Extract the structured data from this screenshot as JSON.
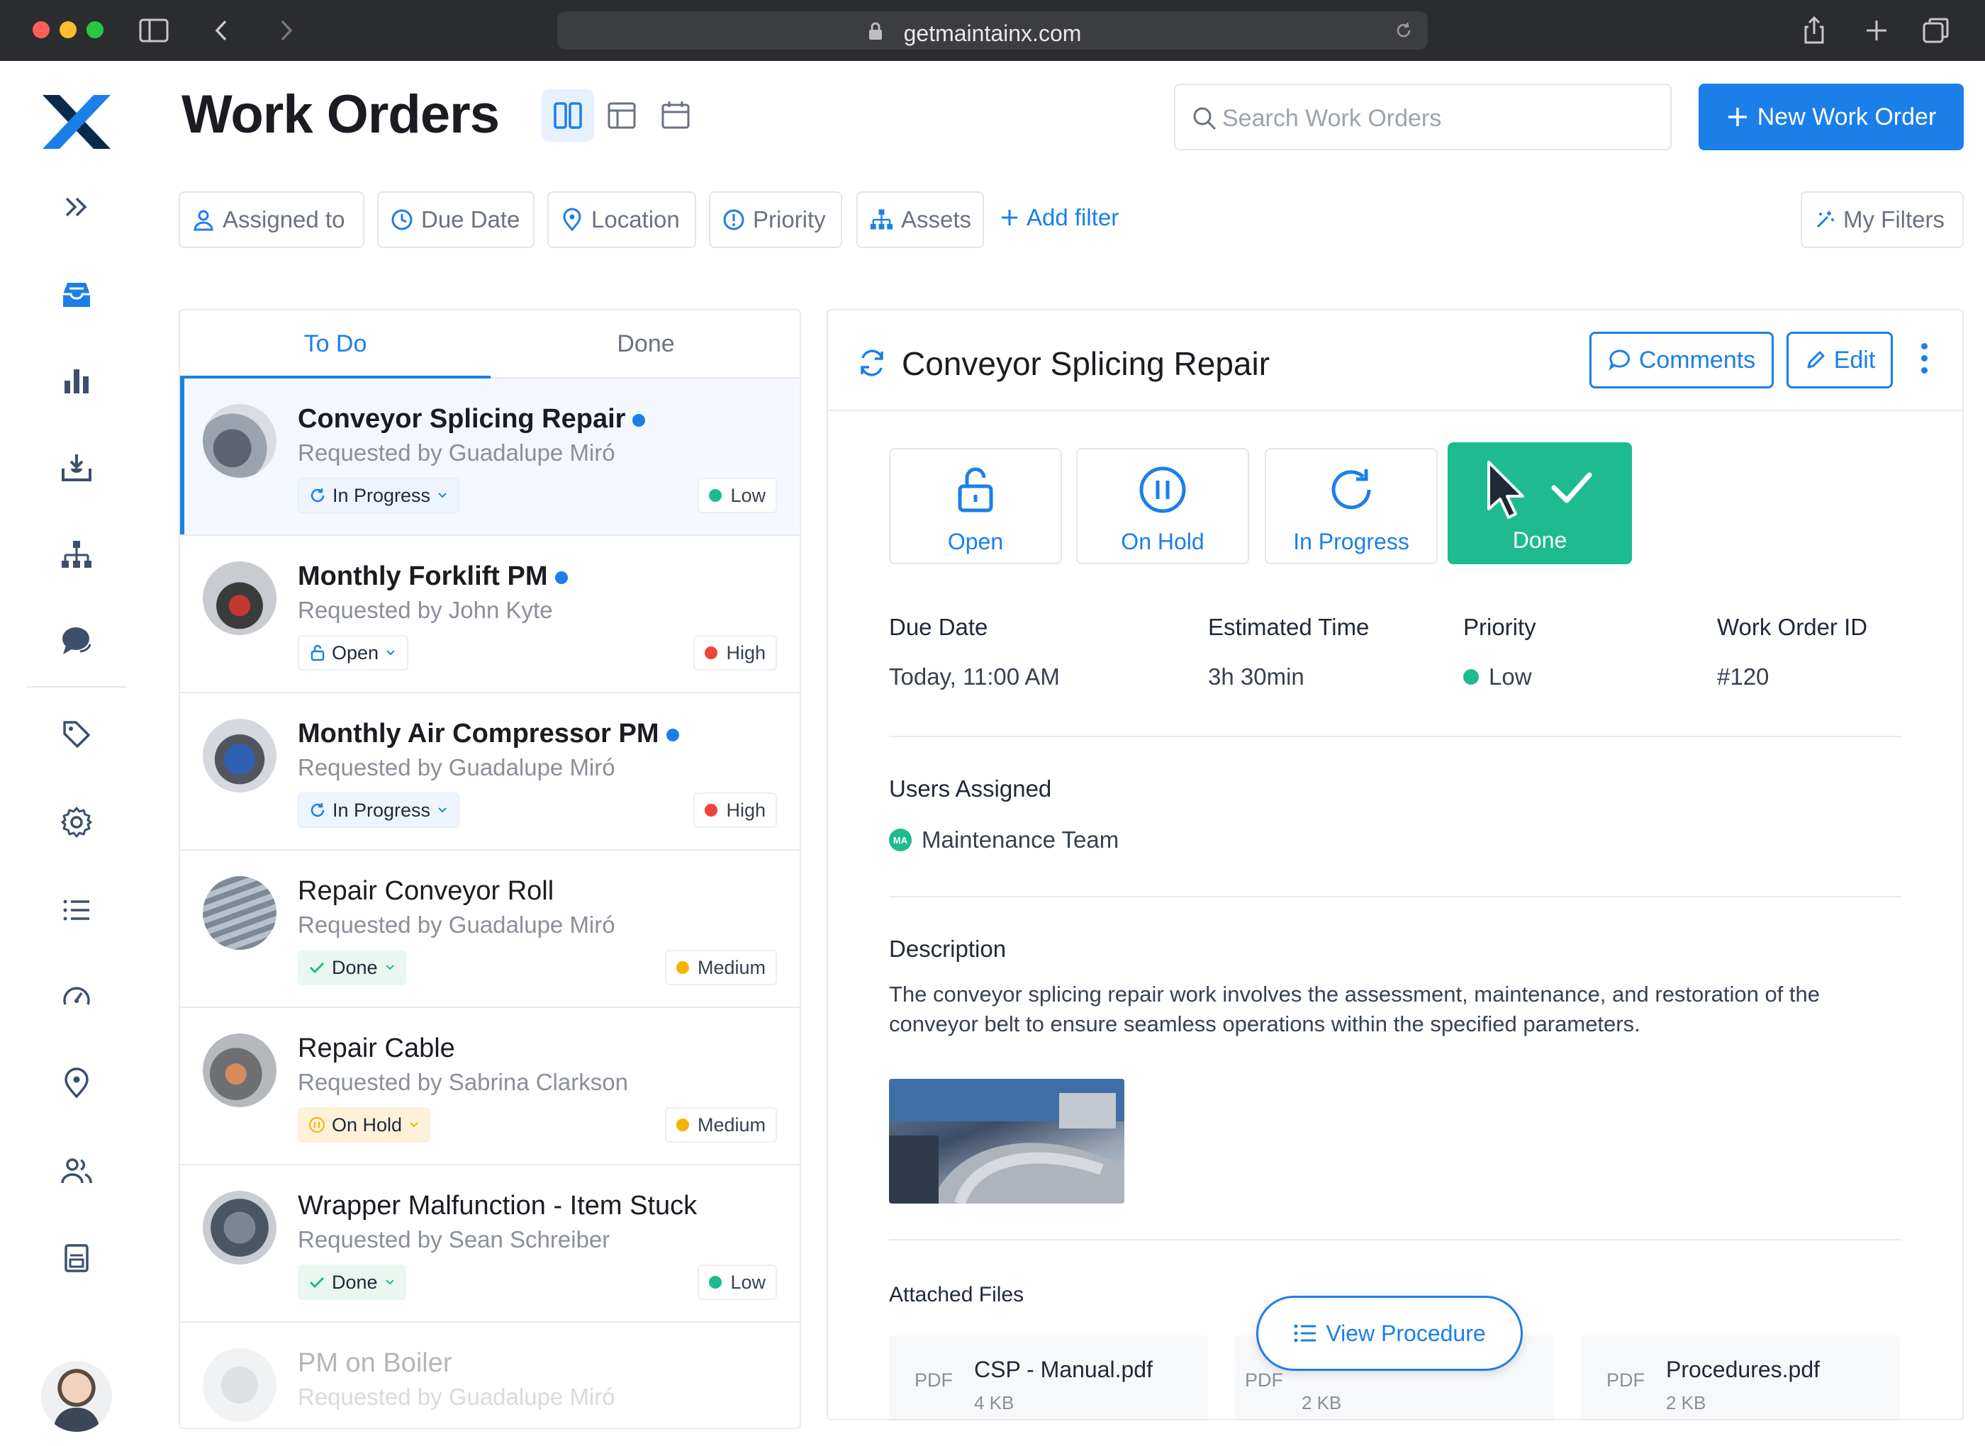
{
  "browser": {
    "url": "getmaintainx.com"
  },
  "header": {
    "title": "Work Orders",
    "search_placeholder": "Search Work Orders",
    "new_button": "New Work Order"
  },
  "filters": {
    "items": [
      "Assigned to",
      "Due Date",
      "Location",
      "Priority",
      "Assets"
    ],
    "add_filter": "Add filter",
    "my_filters": "My Filters"
  },
  "list": {
    "tabs": [
      "To Do",
      "Done"
    ],
    "items": [
      {
        "title": "Conveyor Splicing Repair",
        "requested_by": "Requested by Guadalupe Miró",
        "status": "In Progress",
        "priority": "Low"
      },
      {
        "title": "Monthly Forklift PM",
        "requested_by": "Requested by John Kyte",
        "status": "Open",
        "priority": "High"
      },
      {
        "title": "Monthly Air Compressor PM",
        "requested_by": "Requested by Guadalupe Miró",
        "status": "In Progress",
        "priority": "High"
      },
      {
        "title": "Repair Conveyor Roll",
        "requested_by": "Requested by Guadalupe Miró",
        "status": "Done",
        "priority": "Medium"
      },
      {
        "title": "Repair Cable",
        "requested_by": "Requested by Sabrina Clarkson",
        "status": "On Hold",
        "priority": "Medium"
      },
      {
        "title": "Wrapper Malfunction - Item Stuck",
        "requested_by": "Requested by Sean Schreiber",
        "status": "Done",
        "priority": "Low"
      },
      {
        "title": "PM on Boiler",
        "requested_by": "Requested by Guadalupe Miró"
      }
    ]
  },
  "detail": {
    "title": "Conveyor Splicing Repair",
    "comments_button": "Comments",
    "edit_button": "Edit",
    "status_buttons": [
      "Open",
      "On Hold",
      "In Progress",
      "Done"
    ],
    "fields": {
      "due_date_label": "Due Date",
      "due_date": "Today, 11:00 AM",
      "est_time_label": "Estimated Time",
      "est_time": "3h 30min",
      "priority_label": "Priority",
      "priority": "Low",
      "wo_id_label": "Work Order ID",
      "wo_id": "#120"
    },
    "users_assigned_label": "Users Assigned",
    "team_initials": "MA",
    "team": "Maintenance Team",
    "description_label": "Description",
    "description": "The conveyor splicing repair work involves the assessment, maintenance, and restoration of the conveyor belt to ensure seamless operations within the specified parameters.",
    "attached_files_label": "Attached Files",
    "files": [
      {
        "type": "PDF",
        "name": "CSP - Manual.pdf",
        "size": "4 KB"
      },
      {
        "type": "PDF",
        "name": "",
        "size": "2 KB"
      },
      {
        "type": "PDF",
        "name": "Procedures.pdf",
        "size": "2 KB"
      }
    ],
    "view_procedure": "View Procedure"
  },
  "colors": {
    "accent": "#1b7fea",
    "done_green": "#1dbb8f",
    "priority_low": "#1dbb8f",
    "priority_high": "#ef4436",
    "priority_medium": "#f5b300"
  }
}
